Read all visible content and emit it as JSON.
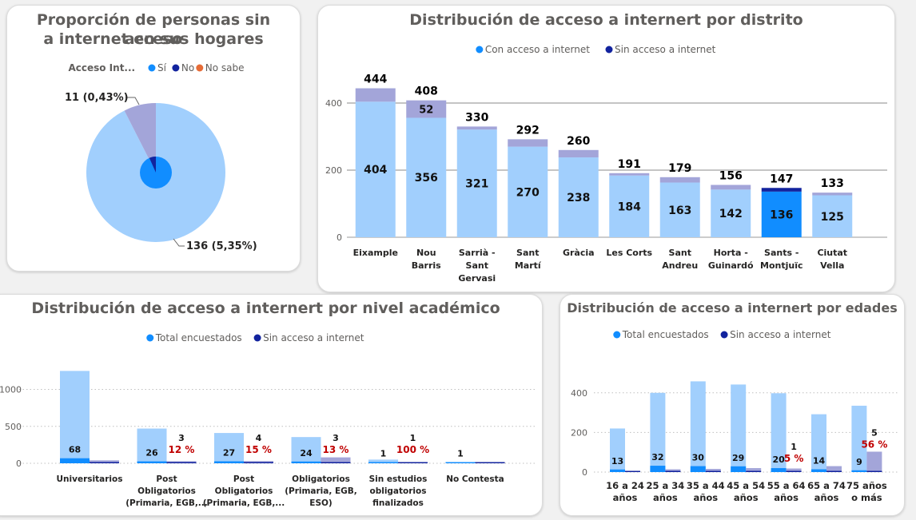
{
  "colors": {
    "light_blue": "#a1cffd",
    "mid_blue": "#118dff",
    "dark_navy": "#12239e",
    "lavender": "#a3a5d9",
    "orange": "#e66c37",
    "red_label": "#c00000",
    "grid": "#bfbfbf",
    "title_gray": "#605e5c"
  },
  "pie_card": {
    "title_line1": "Proporción de personas sin acceso",
    "title_line2": "a internet en sus hogares",
    "legend_title": "Acceso Int...",
    "legend_items": [
      {
        "label": "Sí",
        "color": "#118dff"
      },
      {
        "label": "No",
        "color": "#12239e"
      },
      {
        "label": "No sabe",
        "color": "#e66c37"
      }
    ],
    "chart_data": {
      "type": "pie",
      "slices": [
        {
          "value": 136,
          "label": "136 (5,35%)",
          "color": "#a1cffd"
        },
        {
          "value": 11,
          "label": "11 (0,43%)",
          "color": "#a3a5d9"
        }
      ],
      "inner_circle_colors": [
        "#118dff",
        "#12239e"
      ]
    }
  },
  "district_card": {
    "title": "Distribución de acceso a internert por distrito",
    "legend_items": [
      {
        "label": "Con acceso a internet",
        "color": "#118dff"
      },
      {
        "label": "Sin acceso a internet",
        "color": "#12239e"
      }
    ],
    "chart_data": {
      "type": "bar",
      "categories": [
        "Eixample",
        "Nou Barris",
        "Sarrià - Sant Gervasi",
        "Sant Martí",
        "Gràcia",
        "Les Corts",
        "Sant Andreu",
        "Horta - Guinardó",
        "Sants - Montjuïc",
        "Ciutat Vella"
      ],
      "category_lines": [
        [
          "Eixample"
        ],
        [
          "Nou",
          "Barris"
        ],
        [
          "Sarrià -",
          "Sant",
          "Gervasi"
        ],
        [
          "Sant",
          "Martí"
        ],
        [
          "Gràcia"
        ],
        [
          "Les Corts"
        ],
        [
          "Sant",
          "Andreu"
        ],
        [
          "Horta -",
          "Guinardó"
        ],
        [
          "Sants -",
          "Montjuïc"
        ],
        [
          "Ciutat",
          "Vella"
        ]
      ],
      "series": [
        {
          "name": "Con acceso a internet",
          "values": [
            404,
            356,
            321,
            270,
            238,
            184,
            163,
            142,
            136,
            125
          ]
        },
        {
          "name": "Sin acceso a internet",
          "values": [
            40,
            52,
            9,
            22,
            22,
            7,
            16,
            14,
            11,
            8
          ]
        }
      ],
      "totals": [
        444,
        408,
        330,
        292,
        260,
        191,
        179,
        156,
        147,
        133
      ],
      "segment_labels": [
        null,
        "52",
        null,
        null,
        null,
        null,
        null,
        null,
        null,
        null
      ],
      "yticks": [
        0,
        200,
        400
      ],
      "ylim": [
        0,
        450
      ]
    }
  },
  "academic_card": {
    "title": "Distribución de acceso a internert por nivel académico",
    "legend_items": [
      {
        "label": "Total encuestados",
        "color": "#118dff"
      },
      {
        "label": "Sin acceso a internet",
        "color": "#12239e"
      }
    ],
    "chart_data": {
      "type": "bar",
      "categories": [
        "Universitarios",
        "Post Obligatorios (Primaria, EGB,...",
        "Post Obligatorios (Primaria, EGB,...",
        "Obligatorios (Primaria, EGB, ESO)",
        "Sin estudios obligatorios finalizados",
        "No Contesta"
      ],
      "category_lines": [
        [
          "Universitarios"
        ],
        [
          "Post",
          "Obligatorios",
          "(Primaria, EGB,..."
        ],
        [
          "Post",
          "Obligatorios",
          "(Primaria, EGB,..."
        ],
        [
          "Obligatorios",
          "(Primaria, EGB,",
          "ESO)"
        ],
        [
          "Sin estudios",
          "obligatorios",
          "finalizados"
        ],
        [
          "No Contesta"
        ]
      ],
      "series": [
        {
          "name": "Total encuestados",
          "values": [
            1250,
            470,
            410,
            355,
            50,
            8
          ]
        },
        {
          "name": "Sin acceso a internet",
          "values": [
            40,
            28,
            30,
            80,
            12,
            6
          ]
        }
      ],
      "inner_values": [
        68,
        26,
        27,
        24,
        1,
        1
      ],
      "secondary_labels": [
        null,
        "3",
        "4",
        "3",
        "1",
        null
      ],
      "percent_labels": [
        null,
        "12 %",
        "15 %",
        "13 %",
        "100 %",
        null
      ],
      "yticks": [
        0,
        500,
        1000
      ],
      "ylim": [
        0,
        1300
      ]
    }
  },
  "age_card": {
    "title": "Distribución de acceso a internert por edades",
    "legend_items": [
      {
        "label": "Total encuestados",
        "color": "#118dff"
      },
      {
        "label": "Sin acceso a internet",
        "color": "#12239e"
      }
    ],
    "chart_data": {
      "type": "bar",
      "categories": [
        "16 a 24 años",
        "25 a 34 años",
        "35 a 44 años",
        "45 a 54 años",
        "55 a 64 años",
        "65 a 74 años",
        "75 años o más"
      ],
      "category_lines": [
        [
          "16 a 24",
          "años"
        ],
        [
          "25 a 34",
          "años"
        ],
        [
          "35 a 44",
          "años"
        ],
        [
          "45 a 54",
          "años"
        ],
        [
          "55 a 64",
          "años"
        ],
        [
          "65 a 74",
          "años"
        ],
        [
          "75 años",
          "o más"
        ]
      ],
      "series": [
        {
          "name": "Total encuestados",
          "values": [
            220,
            400,
            458,
            442,
            398,
            292,
            335
          ]
        },
        {
          "name": "Sin acceso a internet",
          "values": [
            3,
            14,
            16,
            20,
            18,
            30,
            103
          ]
        }
      ],
      "inner_values": [
        13,
        32,
        30,
        29,
        20,
        14,
        9
      ],
      "secondary_labels": [
        null,
        null,
        null,
        null,
        "1",
        null,
        "5"
      ],
      "percent_labels": [
        null,
        null,
        null,
        null,
        "5 %",
        null,
        "56 %"
      ],
      "yticks": [
        0,
        200,
        400
      ],
      "ylim": [
        0,
        480
      ]
    }
  }
}
